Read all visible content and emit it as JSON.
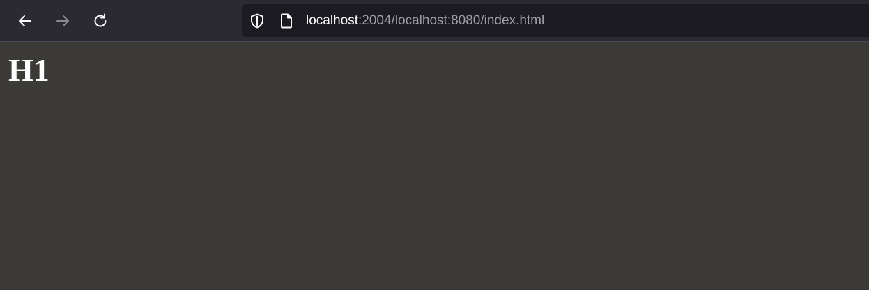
{
  "toolbar": {
    "back_icon": "arrow-left-icon",
    "forward_icon": "arrow-right-icon",
    "reload_icon": "reload-icon"
  },
  "urlbar": {
    "shield_icon": "shield-icon",
    "page_icon": "page-icon",
    "host": "localhost",
    "rest": ":2004/localhost:8080/index.html"
  },
  "page": {
    "heading": "H1"
  },
  "colors": {
    "toolbar_bg": "#2b2a33",
    "urlbar_bg": "#1c1b22",
    "page_bg": "#3b3a36",
    "text_primary": "#fbfbfe",
    "text_dim": "#9f9ea6"
  }
}
